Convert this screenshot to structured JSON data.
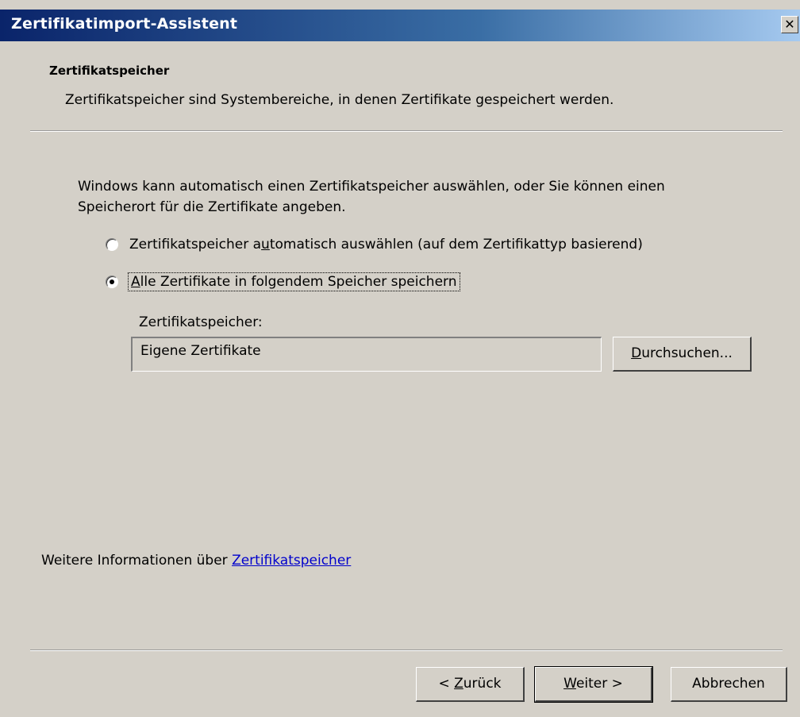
{
  "window": {
    "title": "Zertifikatimport-Assistent",
    "close_glyph": "✕"
  },
  "header": {
    "title": "Zertifikatspeicher",
    "subtitle": "Zertifikatspeicher sind Systembereiche, in denen Zertifikate gespeichert werden."
  },
  "body": {
    "intro": "Windows kann automatisch einen Zertifikatspeicher auswählen, oder Sie können einen Speicherort für die Zertifikate angeben.",
    "options": [
      {
        "label_pre": "Zertifikatspeicher a",
        "label_accel": "u",
        "label_post": "tomatisch auswählen (auf dem Zertifikattyp basierend)",
        "selected": false
      },
      {
        "label_pre": "",
        "label_accel": "A",
        "label_post": "lle Zertifikate in folgendem Speicher speichern",
        "selected": true
      }
    ],
    "store_label": "Zertifikatspeicher:",
    "store_value": "Eigene Zertifikate",
    "browse_accel": "D",
    "browse_rest": "urchsuchen..."
  },
  "footer": {
    "more_info_text": "Weitere Informationen über ",
    "more_info_link": "Zertifikatspeicher",
    "back_prefix": "< ",
    "back_accel": "Z",
    "back_rest": "urück",
    "next_accel": "W",
    "next_rest": "eiter >",
    "cancel_label": "Abbrechen"
  },
  "colors": {
    "titlebar_start": "#0a246a",
    "titlebar_end": "#a6caf0",
    "face": "#d4d0c8",
    "link": "#0000cc"
  }
}
